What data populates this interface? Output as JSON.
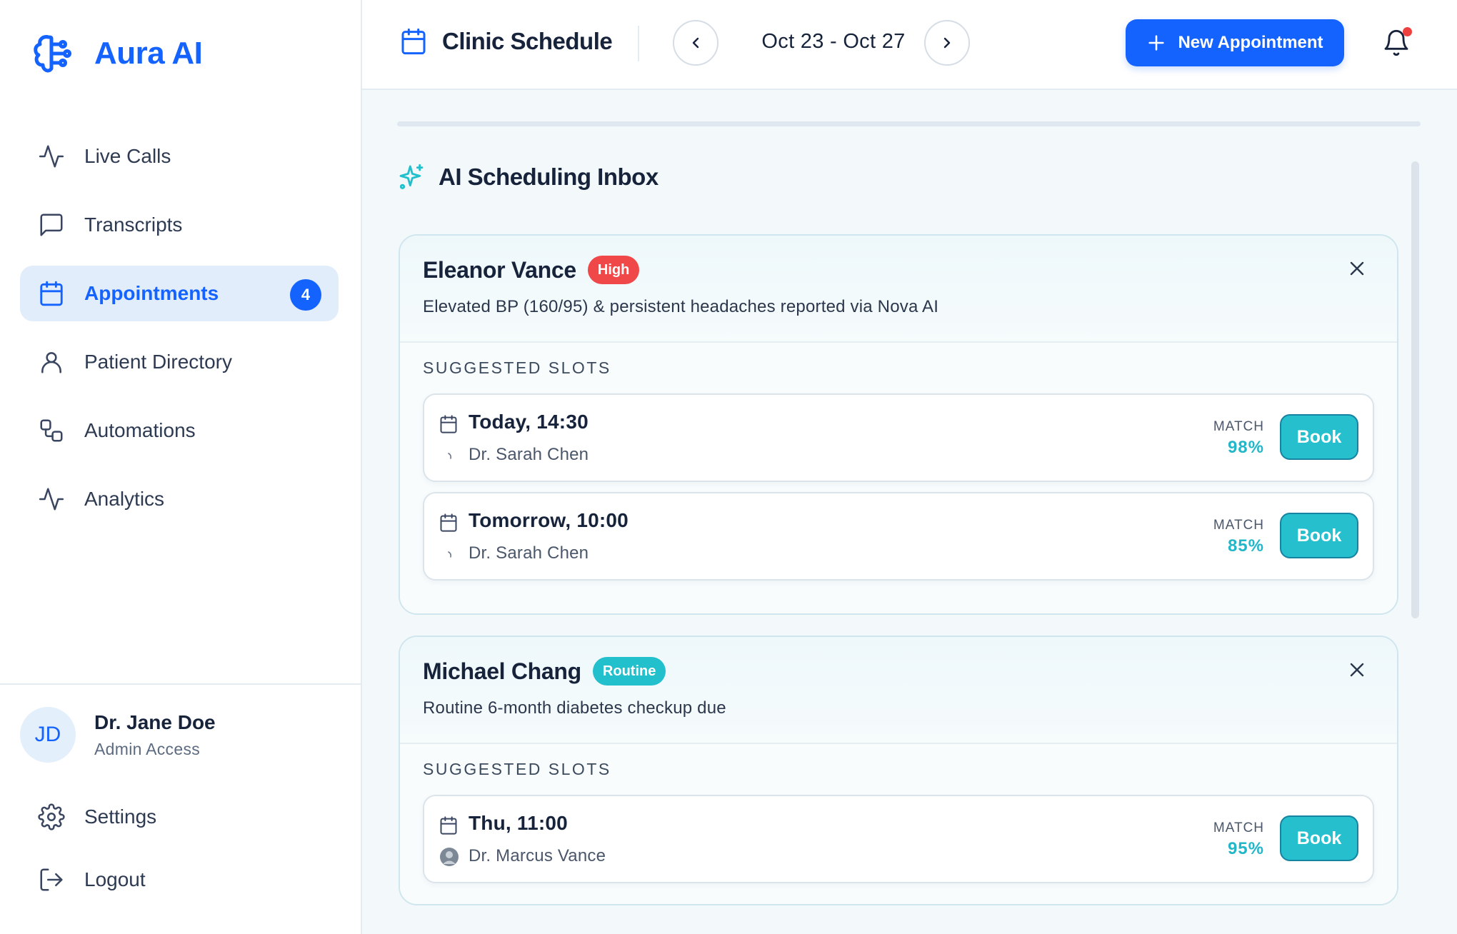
{
  "brand": {
    "name": "Aura AI"
  },
  "sidebar": {
    "items": [
      {
        "label": "Live Calls",
        "icon": "activity-icon"
      },
      {
        "label": "Transcripts",
        "icon": "message-square-icon"
      },
      {
        "label": "Appointments",
        "icon": "calendar-icon",
        "badge": "4",
        "active": true
      },
      {
        "label": "Patient Directory",
        "icon": "user-icon"
      },
      {
        "label": "Automations",
        "icon": "workflow-icon"
      },
      {
        "label": "Analytics",
        "icon": "activity-icon"
      }
    ],
    "user": {
      "initials": "JD",
      "name": "Dr. Jane Doe",
      "role": "Admin Access"
    },
    "settings_label": "Settings",
    "logout_label": "Logout"
  },
  "header": {
    "title": "Clinic Schedule",
    "date_range": "Oct 23 - Oct 27",
    "new_appointment_label": "New Appointment"
  },
  "colors": {
    "accent": "#1463ff",
    "teal": "#22bfcc",
    "high": "#f04848",
    "notification_dot": "#ef4040"
  },
  "inbox": {
    "title": "AI Scheduling Inbox",
    "requests": [
      {
        "name": "Eleanor Vance",
        "priority": "High",
        "description": "Elevated BP (160/95) & persistent headaches reported via Nova AI",
        "slots_label": "SUGGESTED SLOTS",
        "slots": [
          {
            "time": "Today, 14:30",
            "doctor": "Dr. Sarah Chen",
            "match_label": "MATCH",
            "match": "98%",
            "book_label": "Book"
          },
          {
            "time": "Tomorrow, 10:00",
            "doctor": "Dr. Sarah Chen",
            "match_label": "MATCH",
            "match": "85%",
            "book_label": "Book"
          }
        ]
      },
      {
        "name": "Michael Chang",
        "priority": "Routine",
        "description": "Routine 6-month diabetes checkup due",
        "slots_label": "SUGGESTED SLOTS",
        "slots": [
          {
            "time": "Thu, 11:00",
            "doctor": "Dr. Marcus Vance",
            "match_label": "MATCH",
            "match": "95%",
            "book_label": "Book"
          }
        ]
      }
    ]
  }
}
